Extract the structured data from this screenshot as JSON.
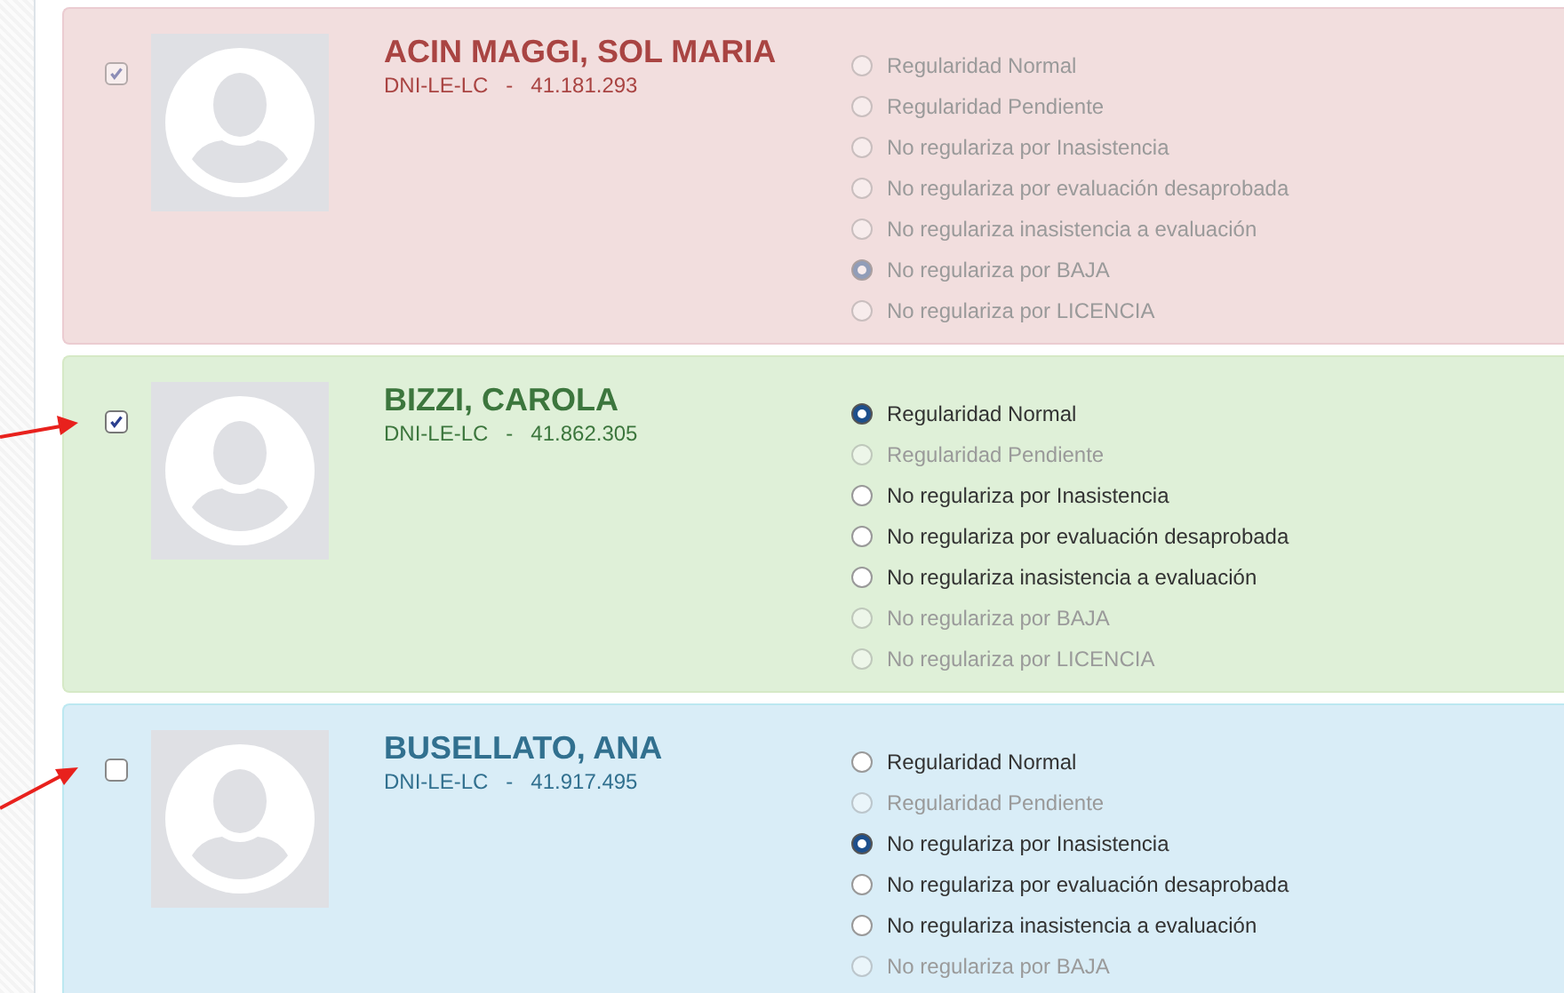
{
  "students": [
    {
      "kind": "danger",
      "name": "ACIN MAGGI, SOL MARIA",
      "document": "DNI-LE-LC   -   41.181.293",
      "selected": true,
      "selection_disabled": true,
      "pointed_at": false,
      "options": [
        {
          "label": "Regularidad Normal",
          "checked": false,
          "disabled": true
        },
        {
          "label": "Regularidad Pendiente",
          "checked": false,
          "disabled": true
        },
        {
          "label": "No regulariza por Inasistencia",
          "checked": false,
          "disabled": true
        },
        {
          "label": "No regulariza por evaluación desaprobada",
          "checked": false,
          "disabled": true
        },
        {
          "label": "No regulariza inasistencia a evaluación",
          "checked": false,
          "disabled": true
        },
        {
          "label": "No regulariza por BAJA",
          "checked": true,
          "disabled": true
        },
        {
          "label": "No regulariza por LICENCIA",
          "checked": false,
          "disabled": true
        }
      ]
    },
    {
      "kind": "success",
      "name": "BIZZI, CAROLA",
      "document": "DNI-LE-LC   -   41.862.305",
      "selected": true,
      "selection_disabled": false,
      "pointed_at": true,
      "options": [
        {
          "label": "Regularidad Normal",
          "checked": true,
          "disabled": false
        },
        {
          "label": "Regularidad Pendiente",
          "checked": false,
          "disabled": true
        },
        {
          "label": "No regulariza por Inasistencia",
          "checked": false,
          "disabled": false
        },
        {
          "label": "No regulariza por evaluación desaprobada",
          "checked": false,
          "disabled": false
        },
        {
          "label": "No regulariza inasistencia a evaluación",
          "checked": false,
          "disabled": false
        },
        {
          "label": "No regulariza por BAJA",
          "checked": false,
          "disabled": true
        },
        {
          "label": "No regulariza por LICENCIA",
          "checked": false,
          "disabled": true
        }
      ]
    },
    {
      "kind": "info",
      "name": "BUSELLATO, ANA",
      "document": "DNI-LE-LC   -   41.917.495",
      "selected": false,
      "selection_disabled": false,
      "pointed_at": true,
      "options": [
        {
          "label": "Regularidad Normal",
          "checked": false,
          "disabled": false
        },
        {
          "label": "Regularidad Pendiente",
          "checked": false,
          "disabled": true
        },
        {
          "label": "No regulariza por Inasistencia",
          "checked": true,
          "disabled": false
        },
        {
          "label": "No regulariza por evaluación desaprobada",
          "checked": false,
          "disabled": false
        },
        {
          "label": "No regulariza inasistencia a evaluación",
          "checked": false,
          "disabled": false
        },
        {
          "label": "No regulariza por BAJA",
          "checked": false,
          "disabled": true
        }
      ]
    }
  ]
}
